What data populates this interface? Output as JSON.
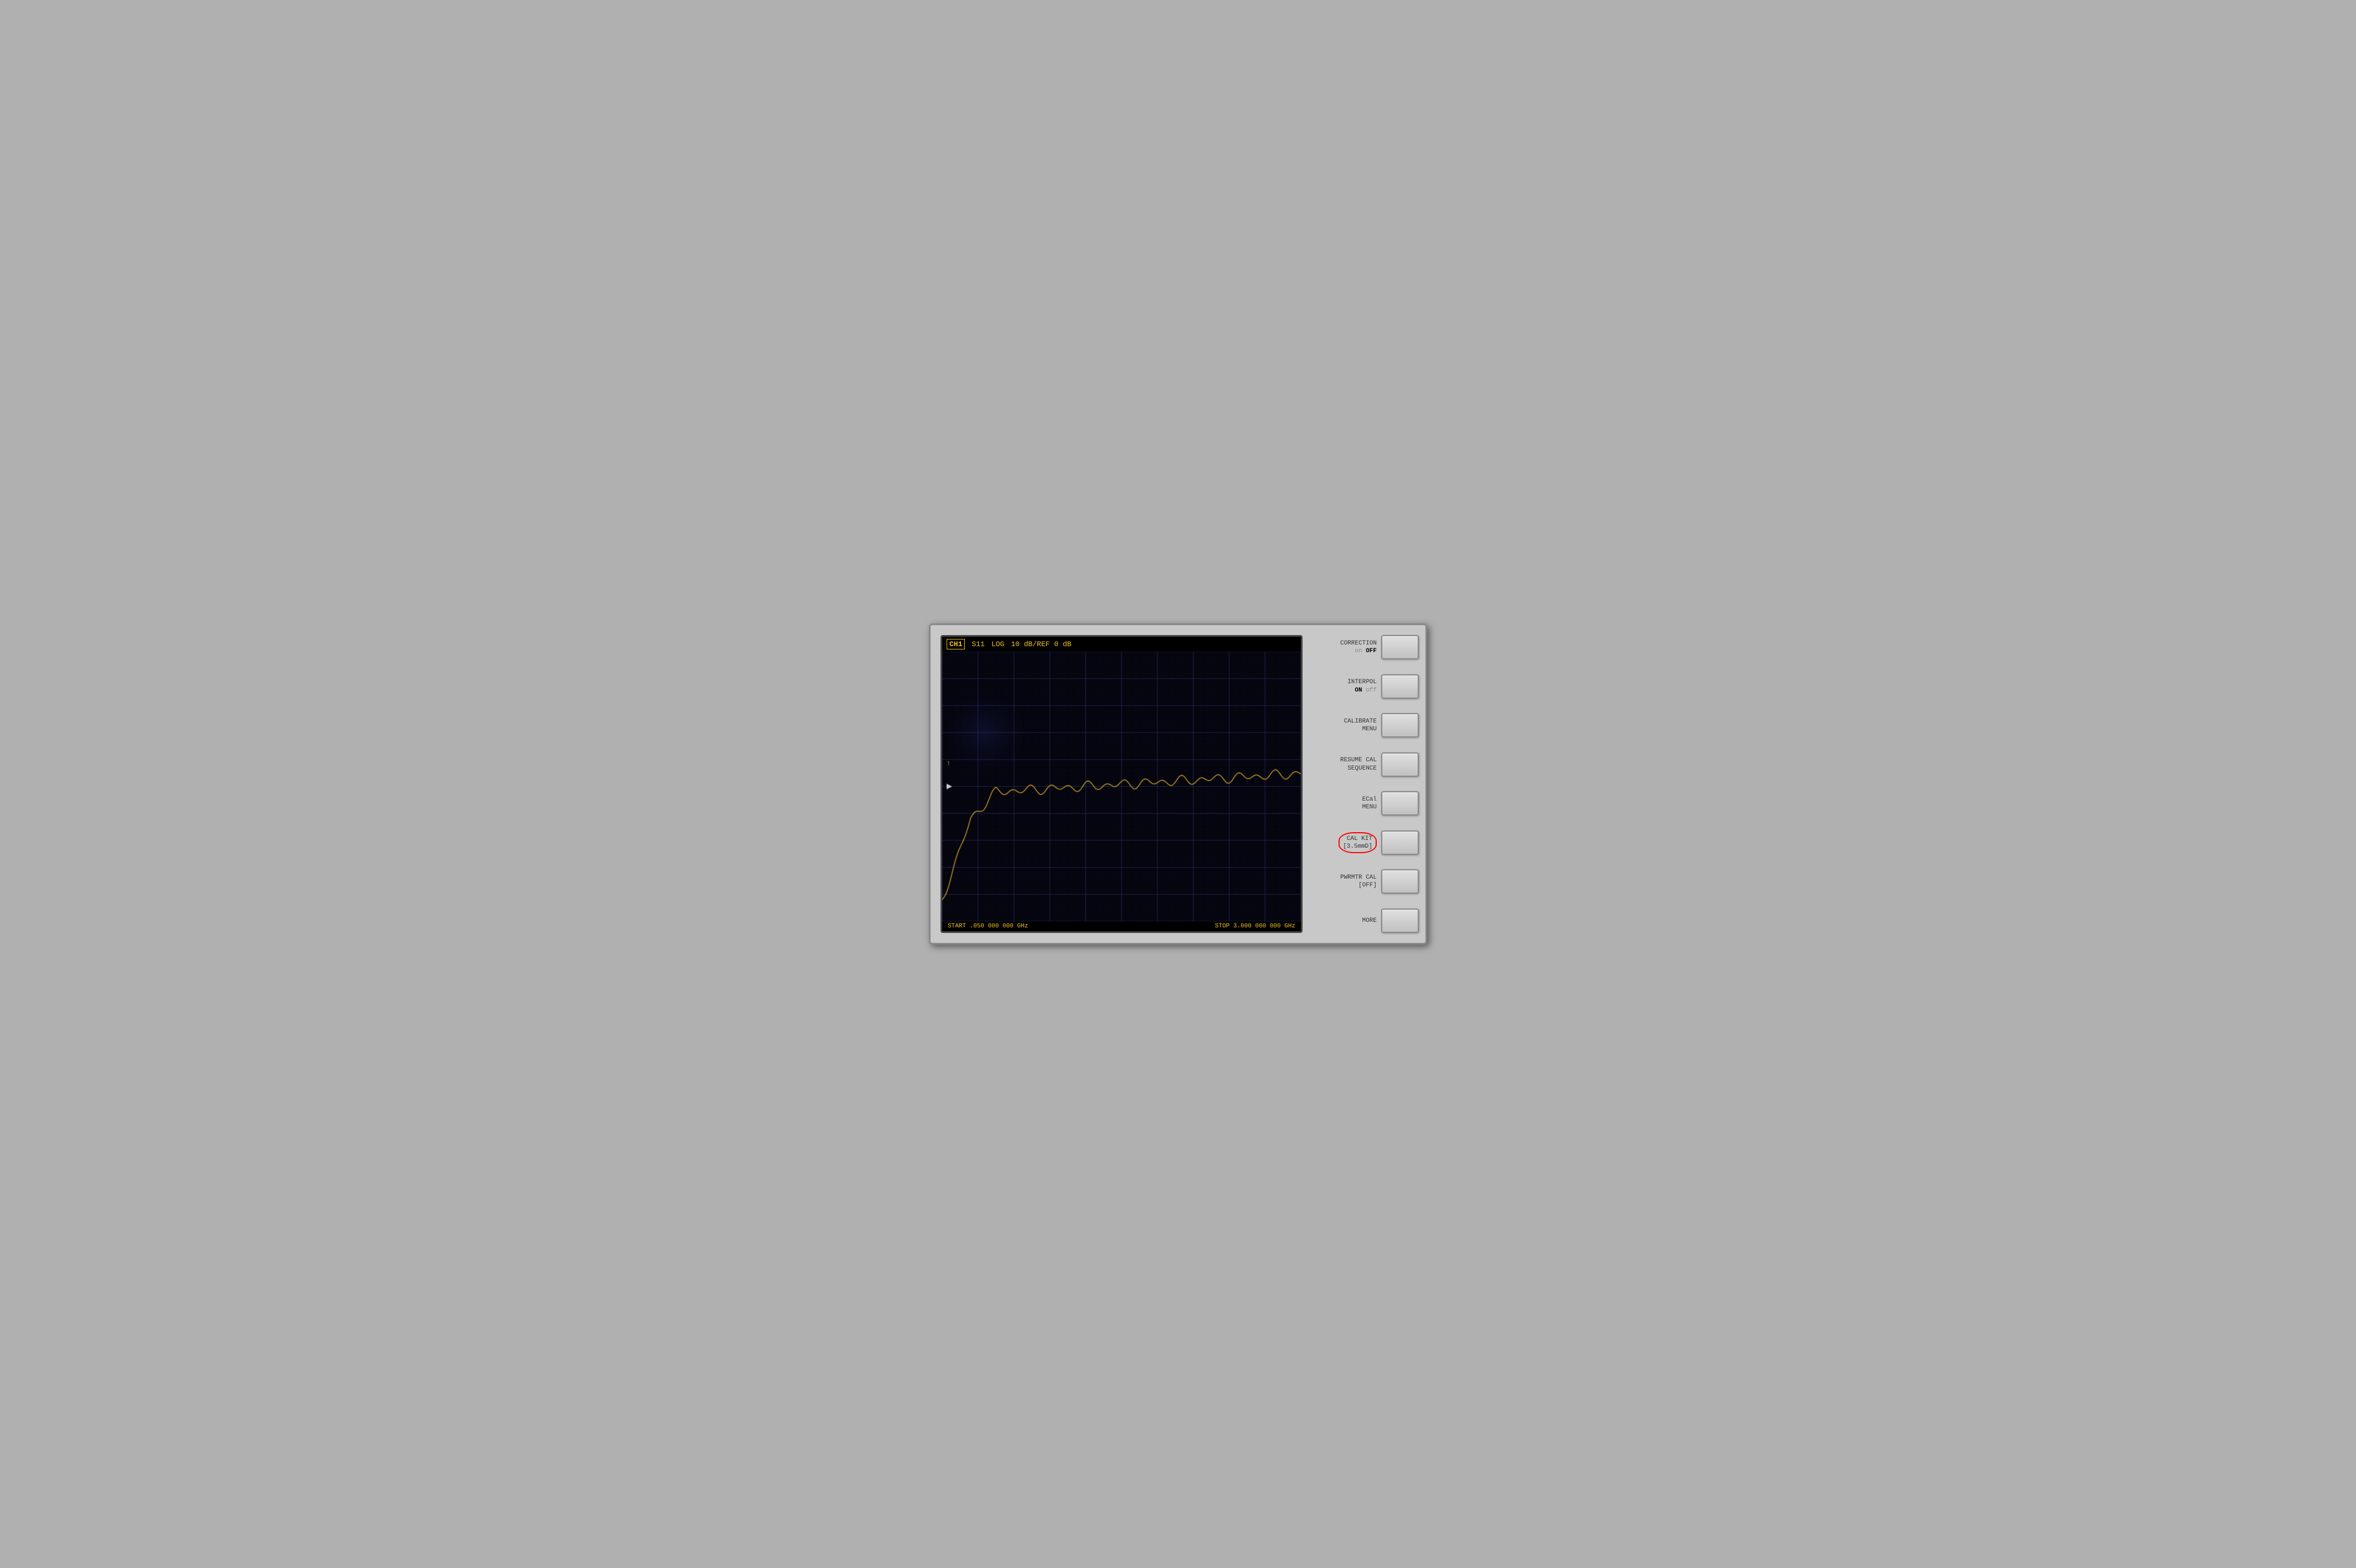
{
  "screen": {
    "ch_label": "CH1",
    "param1": "S11",
    "param2": "LOG",
    "param3": "10 dB/REF 0 dB",
    "start_freq": "START .050 000 000 GHz",
    "stop_freq": "STOP 3.000 000 000 GHz"
  },
  "sidebar": {
    "buttons": [
      {
        "id": "correction",
        "label_line1": "CORRECTION",
        "label_line2": "on OFF",
        "has_active": true,
        "active_word": "OFF",
        "inactive_word": "on"
      },
      {
        "id": "interpol",
        "label_line1": "INTERPOL",
        "label_line2": "ON off",
        "has_active": true,
        "active_word": "ON",
        "inactive_word": "off"
      },
      {
        "id": "calibrate_menu",
        "label_line1": "CALIBRATE",
        "label_line2": "MENU",
        "has_active": false
      },
      {
        "id": "resume_cal",
        "label_line1": "RESUME CAL",
        "label_line2": "SEQUENCE",
        "has_active": false
      },
      {
        "id": "ecal_menu",
        "label_line1": "ECal",
        "label_line2": "MENU",
        "has_active": false
      },
      {
        "id": "cal_kit",
        "label_line1": "CAL KIT",
        "label_line2": "[3.5mmD]",
        "has_active": false,
        "circled": true
      },
      {
        "id": "pwrmtr_cal",
        "label_line1": "PWRMTR CAL",
        "label_line2": "[OFF]",
        "has_active": false
      },
      {
        "id": "more",
        "label_line1": "MORE",
        "label_line2": "",
        "has_active": false
      }
    ]
  }
}
